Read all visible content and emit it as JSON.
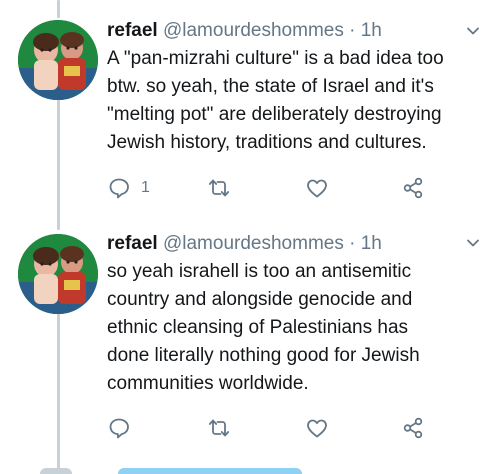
{
  "tweets": [
    {
      "name": "refael",
      "handle": "@lamourdeshommes",
      "separator": "·",
      "time": "1h",
      "text_lines": [
        "A \"pan-mizrahi culture\" is a bad idea too",
        "btw. so yeah, the state of Israel and it's",
        "\"melting pot\" are deliberately destroying",
        "Jewish history, traditions and cultures."
      ],
      "reply_count": "1",
      "icons": [
        "reply-icon",
        "retweet-icon",
        "like-icon",
        "share-icon",
        "chevron-down-icon"
      ]
    },
    {
      "name": "refael",
      "handle": "@lamourdeshommes",
      "separator": "·",
      "time": "1h",
      "text_lines": [
        "so yeah israhell is too an antisemitic",
        "country and alongside genocide and",
        "ethnic cleansing of Palestinians has",
        "done literally nothing good for Jewish",
        "communities worldwide."
      ],
      "reply_count": "",
      "icons": [
        "reply-icon",
        "retweet-icon",
        "like-icon",
        "share-icon",
        "chevron-down-icon"
      ]
    }
  ],
  "colors": {
    "text": "#14171a",
    "secondary": "#657786",
    "thread_line": "#c6d1d8",
    "accent": "#8fd0f5"
  }
}
